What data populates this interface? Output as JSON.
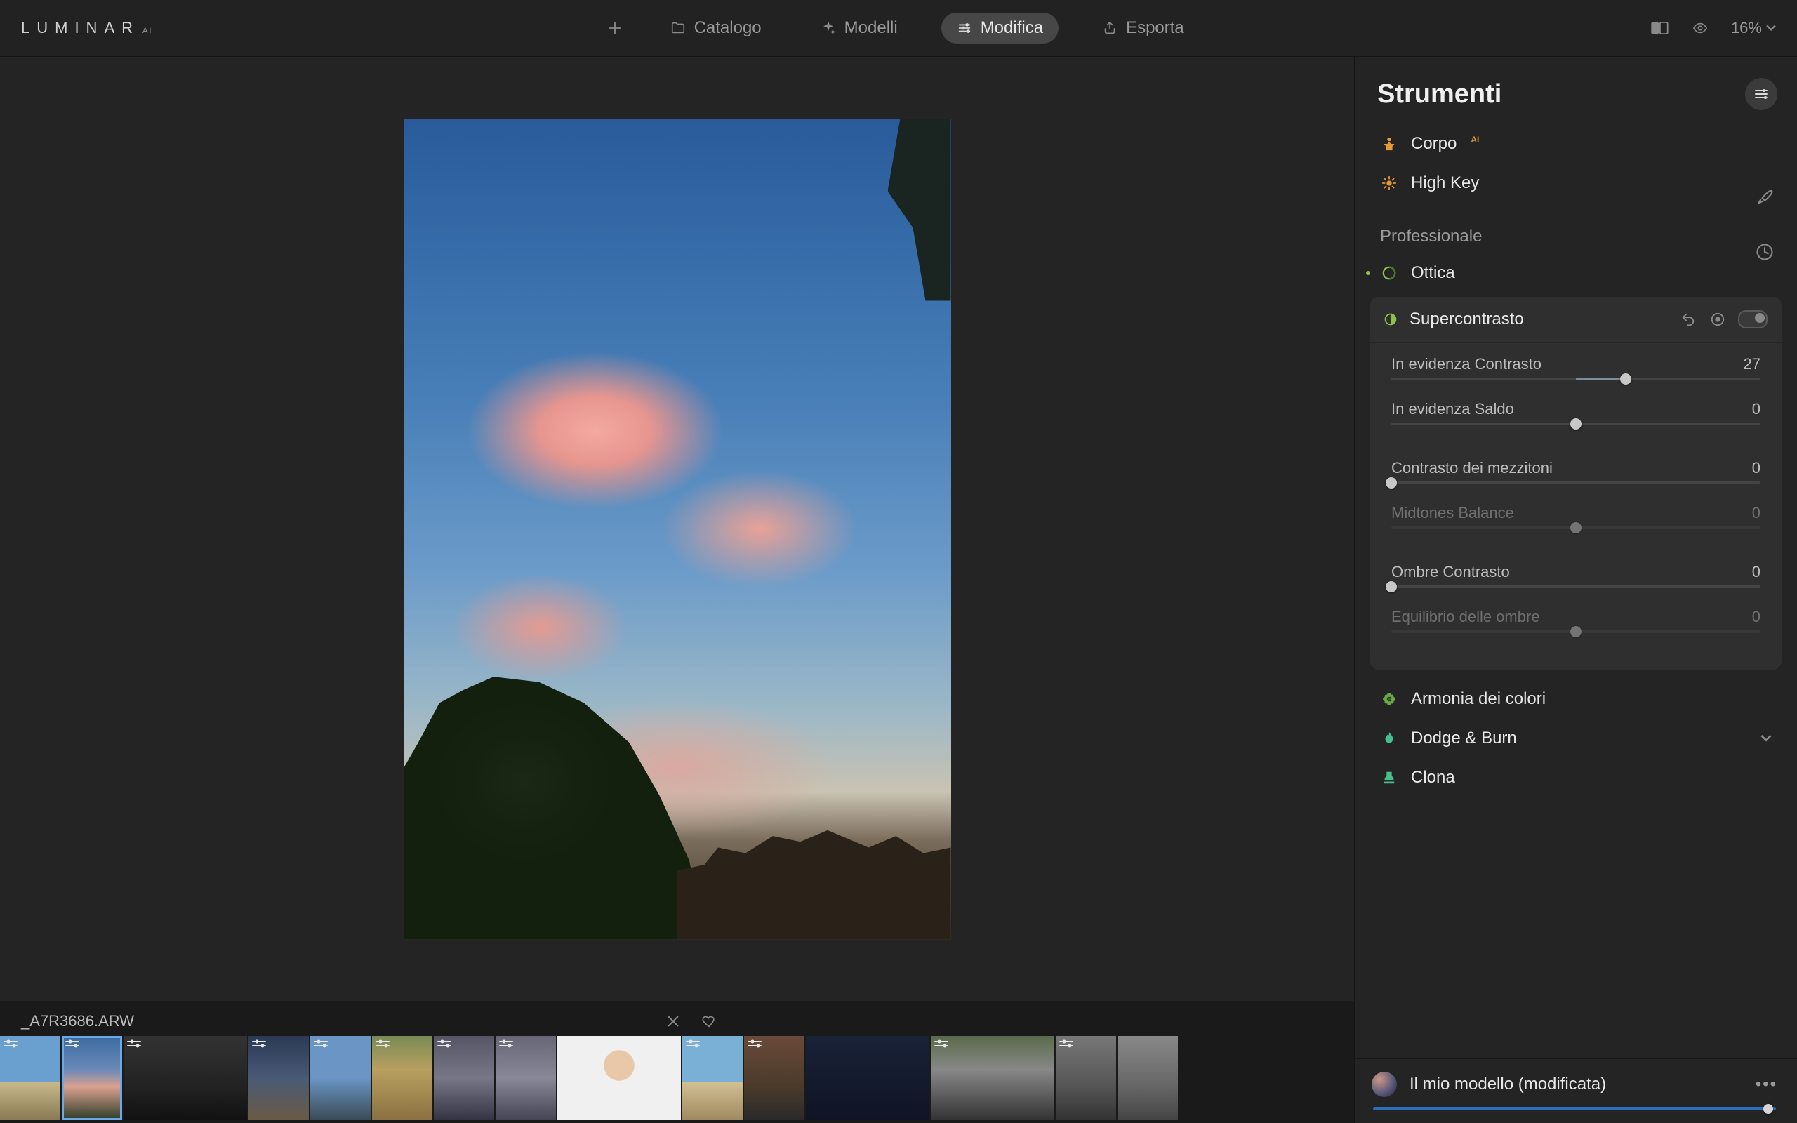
{
  "app": {
    "logo_main": "LUMINAR",
    "logo_sup": "AI"
  },
  "tabs": {
    "catalog": "Catalogo",
    "templates": "Modelli",
    "edit": "Modifica",
    "export": "Esporta"
  },
  "topbar": {
    "zoom": "16%"
  },
  "panel": {
    "title": "Strumenti",
    "section_professional": "Professionale",
    "tools": {
      "body": "Corpo",
      "highkey": "High Key",
      "optics": "Ottica",
      "supercontrast": "Supercontrasto",
      "color_harmony": "Armonia dei colori",
      "dodge_burn": "Dodge & Burn",
      "clone": "Clona"
    }
  },
  "supercontrast": {
    "sliders": [
      {
        "label": "In evidenza Contrasto",
        "value": 27,
        "min": -100,
        "max": 100,
        "bipolar": true
      },
      {
        "label": "In evidenza Saldo",
        "value": 0,
        "min": -100,
        "max": 100,
        "bipolar": true
      },
      {
        "label": "Contrasto dei mezzitoni",
        "value": 0,
        "min": 0,
        "max": 100,
        "bipolar": false
      },
      {
        "label": "Midtones Balance",
        "value": 0,
        "min": -100,
        "max": 100,
        "bipolar": true,
        "dim": true
      },
      {
        "label": "Ombre Contrasto",
        "value": 0,
        "min": 0,
        "max": 100,
        "bipolar": false
      },
      {
        "label": "Equilibrio delle ombre",
        "value": 0,
        "min": -100,
        "max": 100,
        "bipolar": true,
        "dim": true
      }
    ]
  },
  "template": {
    "name": "Il mio modello (modificata)",
    "amount_pct": 98
  },
  "filmstrip": {
    "filename": "_A7R3686.ARW",
    "selected_index": 1,
    "thumbs": [
      {
        "kind": "beach",
        "badge": true
      },
      {
        "kind": "sky",
        "badge": true,
        "selected": true
      },
      {
        "kind": "building",
        "badge": true,
        "wide": true
      },
      {
        "kind": "dusk",
        "badge": true
      },
      {
        "kind": "pier",
        "badge": true
      },
      {
        "kind": "arch",
        "badge": true
      },
      {
        "kind": "photog",
        "badge": true
      },
      {
        "kind": "photog2",
        "badge": true
      },
      {
        "kind": "portrait",
        "badge": false,
        "wide": true
      },
      {
        "kind": "beach2",
        "badge": true
      },
      {
        "kind": "wall",
        "badge": true
      },
      {
        "kind": "night",
        "badge": false,
        "wide": true
      },
      {
        "kind": "jeep",
        "badge": true,
        "wide": true
      },
      {
        "kind": "street",
        "badge": true
      },
      {
        "kind": "street2",
        "badge": false
      }
    ]
  }
}
